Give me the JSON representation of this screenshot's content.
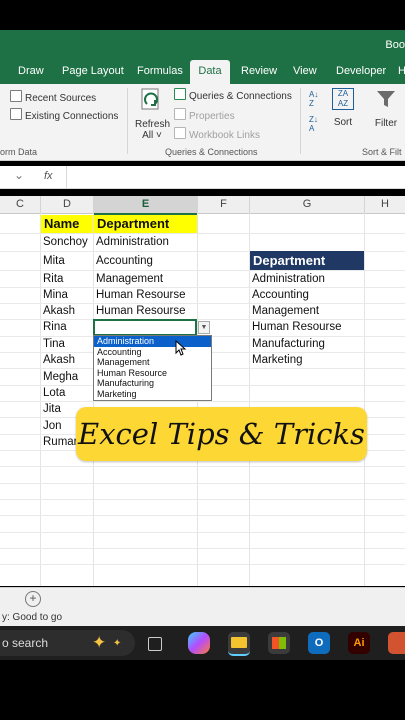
{
  "window": {
    "title_fragment": "Boo"
  },
  "tabs": [
    {
      "label": "Draw",
      "active": false
    },
    {
      "label": "Page Layout",
      "active": false
    },
    {
      "label": "Formulas",
      "active": false
    },
    {
      "label": "Data",
      "active": true
    },
    {
      "label": "Review",
      "active": false
    },
    {
      "label": "View",
      "active": false
    },
    {
      "label": "Developer",
      "active": false
    },
    {
      "label": "H",
      "active": false
    }
  ],
  "ribbon": {
    "recent_sources": "Recent Sources",
    "existing_connections": "Existing Connections",
    "group_form_data": "orm Data",
    "refresh_all_line1": "Refresh",
    "refresh_all_line2": "All ˅",
    "queries_connections": "Queries & Connections",
    "properties": "Properties",
    "workbook_links": "Workbook Links",
    "group_queries": "Queries & Connections",
    "sort": "Sort",
    "filter": "Filter",
    "group_sort_filter": "Sort & Filt"
  },
  "formula_bar": {
    "fx": "fx",
    "chevron": "⌄",
    "value": ""
  },
  "columns": [
    "C",
    "D",
    "E",
    "F",
    "G",
    "H"
  ],
  "table": {
    "header_name": "Name",
    "header_department": "Department",
    "rows": [
      {
        "name": "Sonchoy",
        "department": "Administration"
      },
      {
        "name": "Mita",
        "department": "Accounting"
      },
      {
        "name": "Rita",
        "department": "Management"
      },
      {
        "name": "Mina",
        "department": "Human Resourse"
      },
      {
        "name": "Akash",
        "department": "Human Resourse"
      },
      {
        "name": "Rina",
        "department": ""
      },
      {
        "name": "Tina",
        "department": ""
      },
      {
        "name": "Akash",
        "department": ""
      },
      {
        "name": "Megha",
        "department": ""
      },
      {
        "name": "Lota",
        "department": ""
      },
      {
        "name": "Jita",
        "department": ""
      },
      {
        "name": "Jon",
        "department": ""
      },
      {
        "name": "Rumar",
        "department": ""
      }
    ]
  },
  "lookup_list": {
    "header": "Department",
    "items": [
      "Administration",
      "Accounting",
      "Management",
      "Human Resourse",
      "Manufacturing",
      "Marketing"
    ]
  },
  "dropdown": {
    "selected_index": 0,
    "options": [
      "Administration",
      "Accounting",
      "Management",
      "Human Resource",
      "Manufacturing",
      "Marketing"
    ]
  },
  "banner": {
    "text": "Excel Tips & Tricks"
  },
  "status_bar": {
    "text": "y: Good to go",
    "add_sheet": "+"
  },
  "taskbar": {
    "search_text": "o search"
  },
  "colors": {
    "excel_green": "#1e7145",
    "header_yellow": "#ffff00",
    "navy": "#1f3864",
    "banner": "#fdd835",
    "dropdown_highlight": "#0b61c9"
  }
}
